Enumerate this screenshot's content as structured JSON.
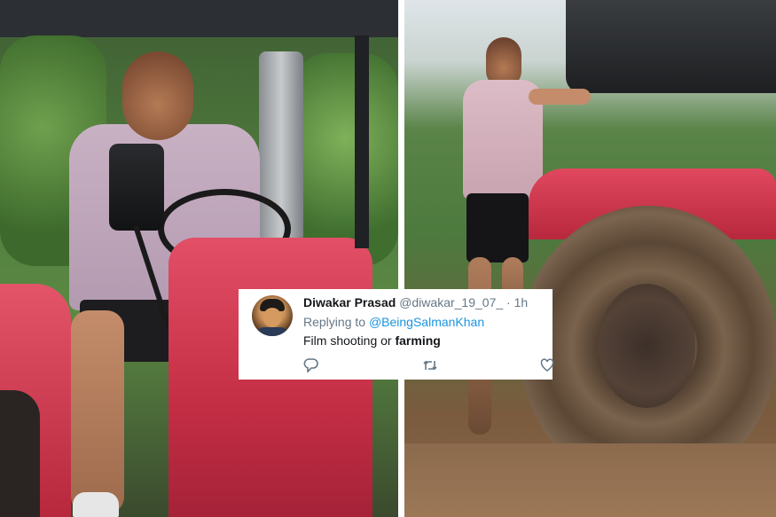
{
  "tweet": {
    "name": "Diwakar Prasad",
    "handle": "@diwakar_19_07_",
    "separator": "·",
    "time": "1h",
    "replying_prefix": "Replying to",
    "replying_to": "@BeingSalmanKhan",
    "text_plain": "Film shooting or",
    "text_bold": "farming"
  },
  "icons": {
    "reply": "comment-icon",
    "retweet": "retweet-icon",
    "like": "heart-icon"
  },
  "colors": {
    "name": "#14171a",
    "muted": "#657786",
    "link": "#1b95e0",
    "tractor_red": "#d5344a"
  }
}
